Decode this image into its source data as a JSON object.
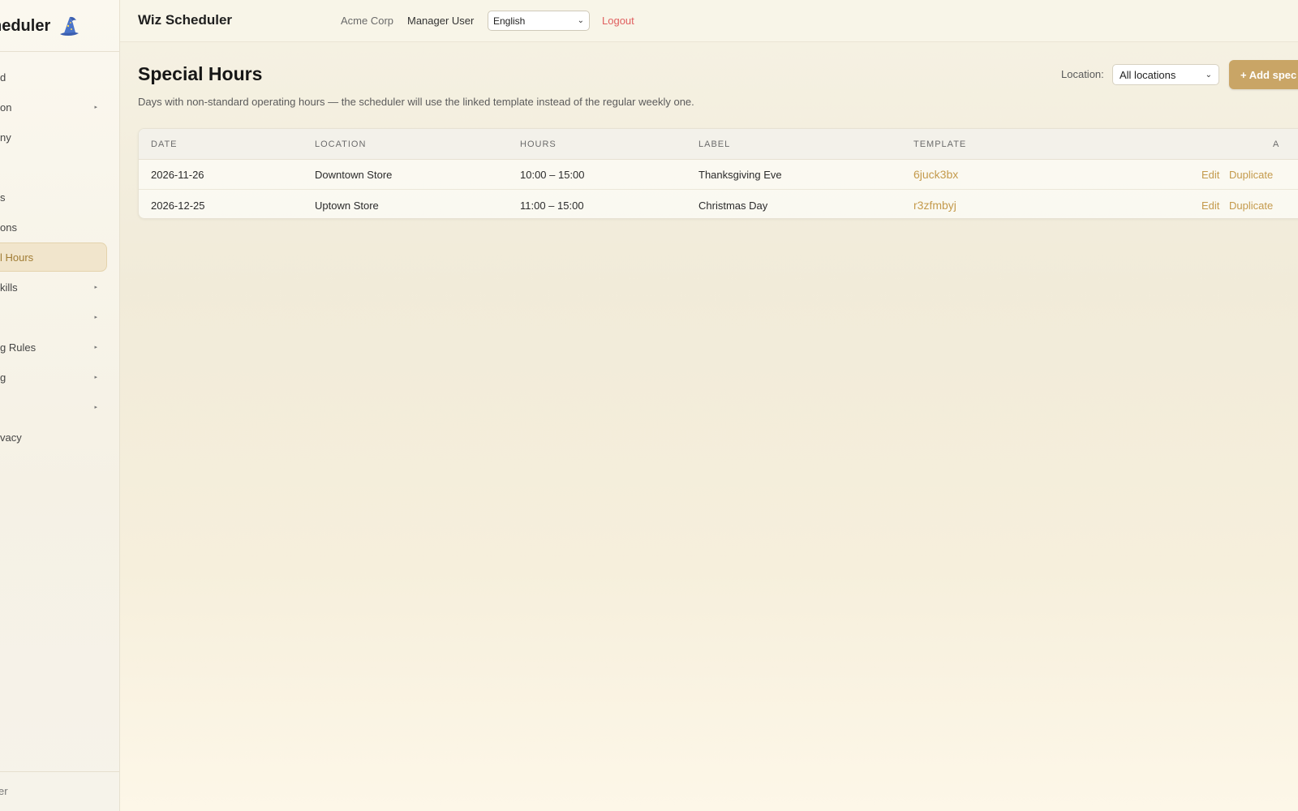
{
  "sidebar": {
    "brand": "Wiz Scheduler",
    "brand_visible": "heduler",
    "items": [
      {
        "label": "d",
        "caret": false
      },
      {
        "label": "on",
        "caret": true
      },
      {
        "label": "ny",
        "caret": false
      },
      {
        "label": "",
        "caret": false
      },
      {
        "label": "s",
        "caret": false
      },
      {
        "label": "ons",
        "caret": false
      },
      {
        "label": "l Hours",
        "caret": false,
        "active": true
      },
      {
        "label": "kills",
        "caret": true
      },
      {
        "label": "",
        "caret": true
      },
      {
        "label": "g Rules",
        "caret": true
      },
      {
        "label": "g",
        "caret": true
      },
      {
        "label": "",
        "caret": true
      },
      {
        "label": "vacy",
        "caret": false
      }
    ],
    "footer": "er"
  },
  "header": {
    "app_title": "Wiz Scheduler",
    "company": "Acme Corp",
    "user": "Manager User",
    "language": "English",
    "logout": "Logout"
  },
  "main": {
    "title": "Special Hours",
    "description": "Days with non-standard operating hours — the scheduler will use the linked template instead of the regular weekly one.",
    "location_label": "Location:",
    "location_value": "All locations",
    "add_button": "+ Add spec",
    "table": {
      "columns": [
        "Date",
        "Location",
        "Hours",
        "Label",
        "Template",
        "A"
      ],
      "rows": [
        {
          "date": "2026-11-26",
          "location": "Downtown Store",
          "hours": "10:00 – 15:00",
          "label": "Thanksgiving Eve",
          "template": "6juck3bx",
          "edit": "Edit",
          "duplicate": "Duplicate"
        },
        {
          "date": "2026-12-25",
          "location": "Uptown Store",
          "hours": "11:00 – 15:00",
          "label": "Christmas Day",
          "template": "r3zfmbyj",
          "edit": "Edit",
          "duplicate": "Duplicate"
        }
      ]
    }
  },
  "colors": {
    "accent": "#c9a566",
    "logout": "#e06060",
    "active_nav_bg": "#f1e5cc"
  },
  "icons": {
    "brand": "wizard-hat-icon",
    "select_chevron": "chevron-down-icon",
    "nav_caret": "caret-right-icon"
  }
}
